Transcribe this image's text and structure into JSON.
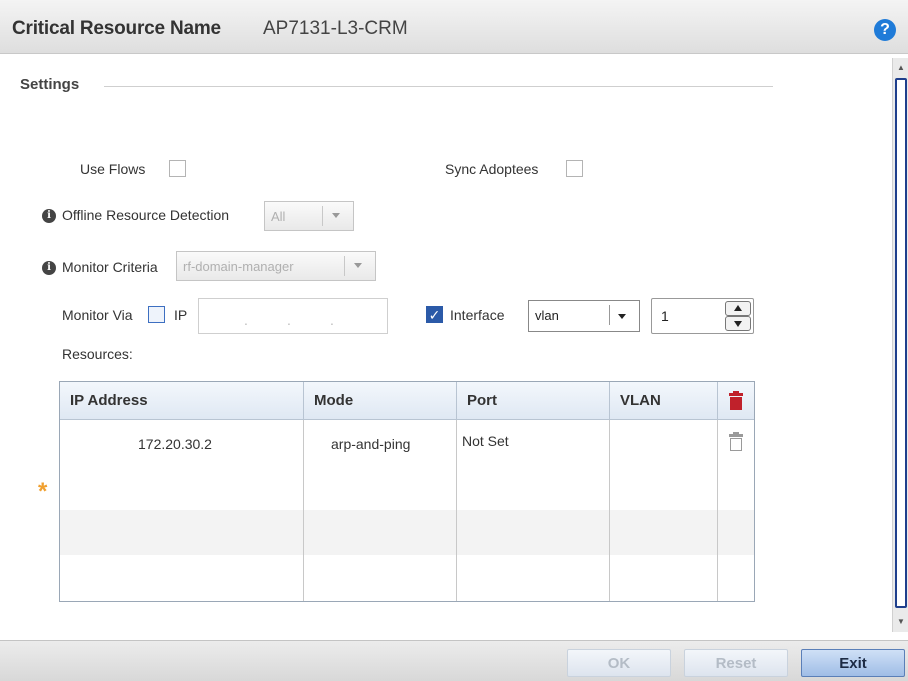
{
  "header": {
    "title": "Critical Resource Name",
    "value": "AP7131-L3-CRM",
    "help_icon": "question-circle-icon"
  },
  "settings": {
    "legend": "Settings",
    "use_flows_label": "Use Flows",
    "use_flows_checked": false,
    "sync_adoptees_label": "Sync Adoptees",
    "sync_adoptees_checked": false,
    "offline_detection_label": "Offline Resource Detection",
    "offline_detection_value": "All",
    "monitor_criteria_label": "Monitor Criteria",
    "monitor_criteria_value": "rf-domain-manager",
    "monitor_via_label": "Monitor Via",
    "ip_label": "IP",
    "ip_checked": false,
    "ip_dots": [
      ".",
      ".",
      "."
    ],
    "interface_label": "Interface",
    "interface_checked": true,
    "interface_type_value": "vlan",
    "interface_number_value": "1",
    "resources_label": "Resources:"
  },
  "table": {
    "columns": [
      "IP Address",
      "Mode",
      "Port",
      "VLAN"
    ],
    "rows": [
      {
        "ip_address": "172.20.30.2",
        "mode": "arp-and-ping",
        "port": "Not Set",
        "vlan": ""
      }
    ]
  },
  "footer": {
    "ok_label": "OK",
    "reset_label": "Reset",
    "exit_label": "Exit"
  },
  "colors": {
    "accent": "#1f7bd8",
    "delete_red": "#c0212b",
    "required_star": "#f0a030"
  }
}
